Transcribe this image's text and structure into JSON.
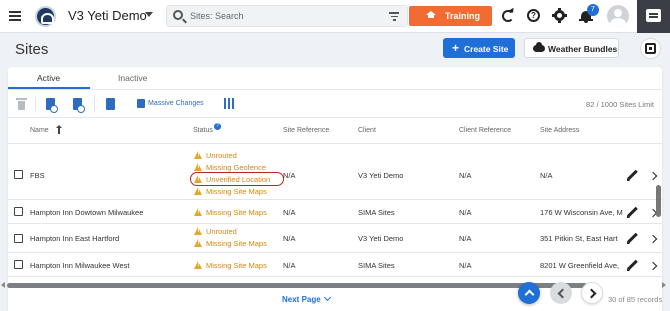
{
  "topbar": {
    "org_name": "V3 Yeti Demo",
    "search_placeholder": "Sites: Search",
    "training_label": "Training",
    "notification_count": "7",
    "accent_color": "#f26b33"
  },
  "header": {
    "title": "Sites",
    "create_label": "Create Site",
    "weather_label": "Weather Bundles"
  },
  "tabs": [
    {
      "label": "Active",
      "active": true
    },
    {
      "label": "Inactive",
      "active": false
    }
  ],
  "toolbar": {
    "massive_label": "Massive Changes",
    "limit_text": "82 / 1000 Sites Limit"
  },
  "table": {
    "columns": [
      "Name",
      "Status",
      "Site Reference",
      "Client",
      "Client Reference",
      "Site Address"
    ],
    "rows": [
      {
        "name": "FBS",
        "statuses": [
          "Unrouted",
          "Missing Geofence",
          "Unverified Location",
          "Missing Site Maps"
        ],
        "site_reference": "N/A",
        "client": "V3 Yeti Demo",
        "client_reference": "N/A",
        "address": "N/A"
      },
      {
        "name": "Hampton Inn Dowtown Milwaukee",
        "statuses": [
          "Missing Site Maps"
        ],
        "site_reference": "N/A",
        "client": "SIMA Sites",
        "client_reference": "N/A",
        "address": "176 W Wisconsin Ave, M"
      },
      {
        "name": "Hampton Inn East Hartford",
        "statuses": [
          "Unrouted",
          "Missing Site Maps"
        ],
        "site_reference": "N/A",
        "client": "V3 Yeti Demo",
        "client_reference": "N/A",
        "address": "351 Pitkin St, East Hart"
      },
      {
        "name": "Hampton Inn Milwaukee West",
        "statuses": [
          "Missing Site Maps"
        ],
        "site_reference": "N/A",
        "client": "SIMA Sites",
        "client_reference": "N/A",
        "address": "8201 W Greenfield Ave,"
      }
    ]
  },
  "footer": {
    "next_page_label": "Next Page",
    "records_text": "30 of 85 records"
  }
}
